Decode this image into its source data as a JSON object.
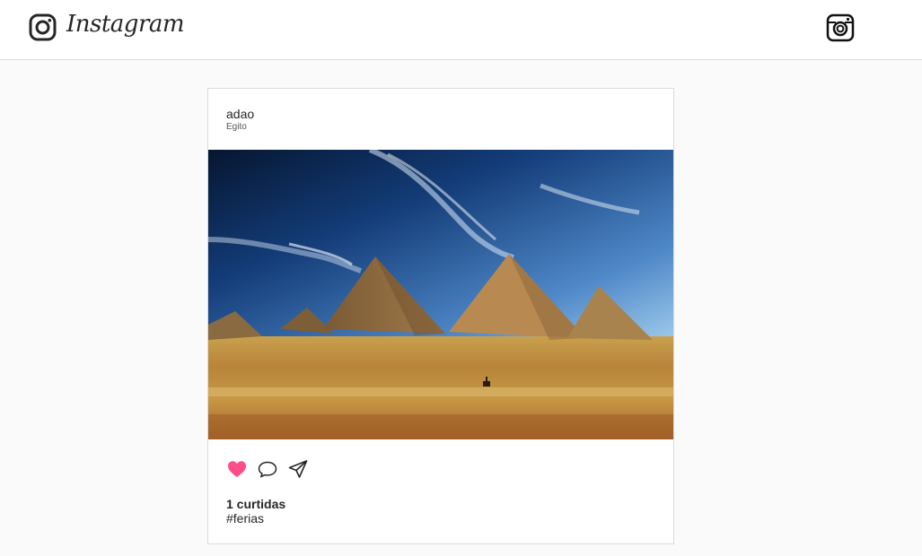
{
  "header": {
    "brand": "Instagram",
    "logo_icon": "instagram-glyph-icon",
    "new_post_icon": "camera-icon"
  },
  "post": {
    "author": "adao",
    "place": "Egito",
    "photo": "pyramids-of-giza-photo",
    "actions": {
      "like_icon": "heart-icon",
      "liked": true,
      "comment_icon": "speech-bubble-icon",
      "share_icon": "paper-plane-icon"
    },
    "likes": "1 curtidas",
    "description": "#ferias"
  },
  "colors": {
    "like": "#ff4d88",
    "text": "#262626",
    "border": "#dbdbdb",
    "background": "#fafafa"
  }
}
